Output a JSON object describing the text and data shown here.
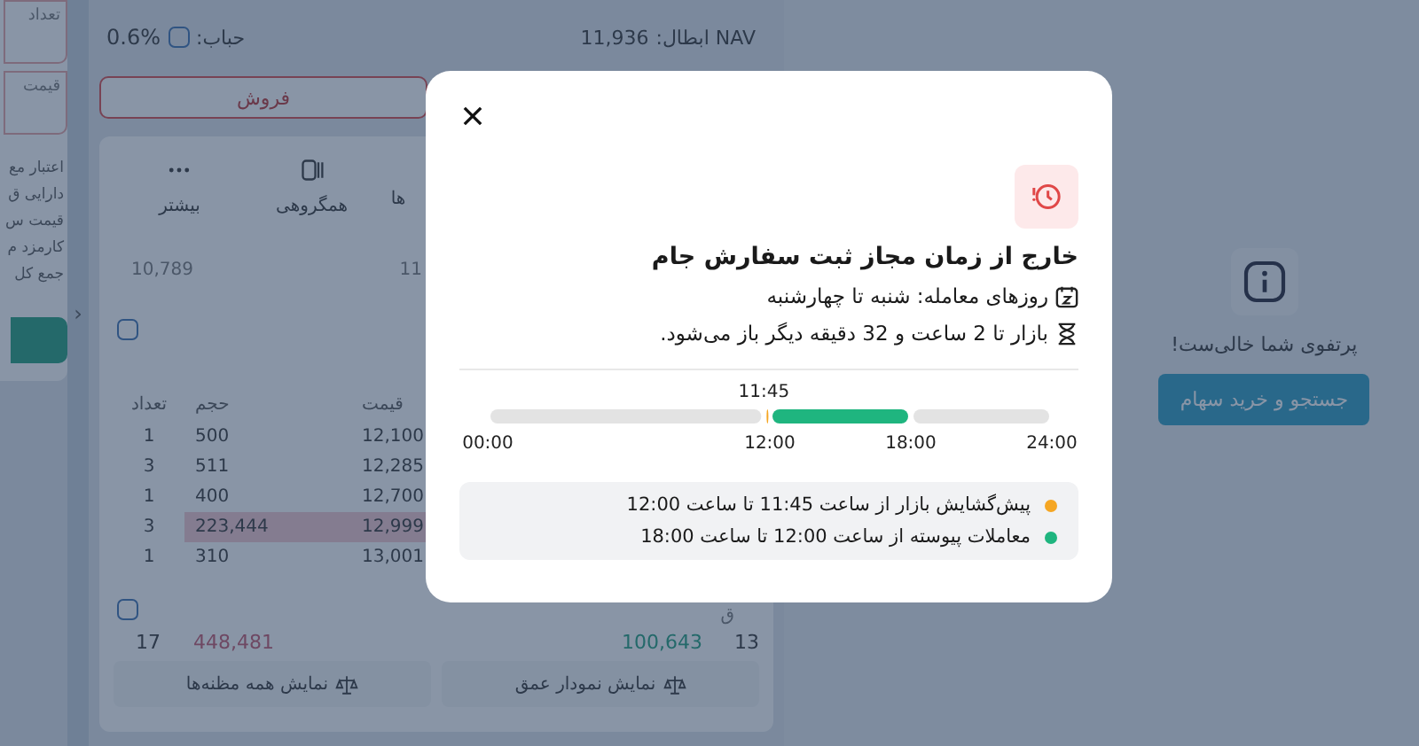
{
  "order_form": {
    "fields": [
      {
        "label": "تعداد"
      },
      {
        "label": "قیمت"
      }
    ],
    "lines": [
      "اعتبار مع",
      "دارایی ق",
      "قیمت س",
      "کارمزد م",
      "جمع کل"
    ]
  },
  "symbol": {
    "nav_label": "NAV ابطال:",
    "nav_value": "11,936",
    "bubble_label": "حباب:",
    "bubble_value": "0.6%",
    "sell_button": "فروش"
  },
  "tabs": [
    {
      "label": "ها"
    },
    {
      "label": "همگروهی"
    },
    {
      "label": "بیشتر"
    }
  ],
  "summary": [
    "11",
    "10,789"
  ],
  "collapse_handle": "‹",
  "order_book": {
    "columns": [
      "قیمت",
      "حجم",
      "تعداد"
    ],
    "rows": [
      {
        "cells": [
          "12,100",
          "500",
          "1"
        ],
        "highlighted": false
      },
      {
        "cells": [
          "12,285",
          "511",
          "3"
        ],
        "highlighted": false
      },
      {
        "cells": [
          "12,700",
          "400",
          "1"
        ],
        "highlighted": false
      },
      {
        "cells": [
          "12,999",
          "223,444",
          "3"
        ],
        "highlighted": true
      },
      {
        "cells": [
          "13,001",
          "310",
          "1"
        ],
        "highlighted": false
      }
    ],
    "side_label": "ق",
    "totals": {
      "sell_count": "17",
      "sell_volume": "448,481",
      "buy_volume": "100,643",
      "buy_count": "13"
    },
    "buttons": [
      "نمایش نمودار عمق",
      "نمایش همه مظنه‌ها"
    ]
  },
  "portfolio": {
    "message": "پرتفوی شما خالی‌ست!",
    "button": "جستجو و خرید سهام"
  },
  "dialog": {
    "title": "خارج از زمان مجاز ثبت سفارش جام",
    "lines": [
      {
        "kind": "calendar",
        "text": "روزهای معامله: شنبه تا چهارشنبه"
      },
      {
        "kind": "hourglass",
        "text": "بازار تا 2 ساعت و 32 دقیقه دیگر باز می‌شود."
      }
    ],
    "chart_data": {
      "type": "bar",
      "orientation": "horizontal",
      "stacked": true,
      "xlim": [
        0,
        24
      ],
      "xticks": [
        {
          "value": 0,
          "label": "00:00"
        },
        {
          "value": 12,
          "label": "12:00"
        },
        {
          "value": 18,
          "label": "18:00"
        },
        {
          "value": 24,
          "label": "24:00"
        }
      ],
      "series": [
        {
          "color": "#e3e3e3",
          "values": [
            11.75
          ]
        },
        {
          "color": "#f5a623",
          "values": [
            0.25
          ]
        },
        {
          "color": "#1fb57f",
          "values": [
            6
          ]
        },
        {
          "color": "#e3e3e3",
          "values": [
            6
          ]
        }
      ],
      "annotations": [
        "11:45"
      ]
    },
    "legend": [
      {
        "color": "#f5a623",
        "text": "پیش‌گشایش بازار از ساعت 11:45 تا ساعت 12:00"
      },
      {
        "color": "#1fb57f",
        "text": "معاملات پیوسته از ساعت 12:00 تا ساعت 18:00"
      }
    ]
  }
}
